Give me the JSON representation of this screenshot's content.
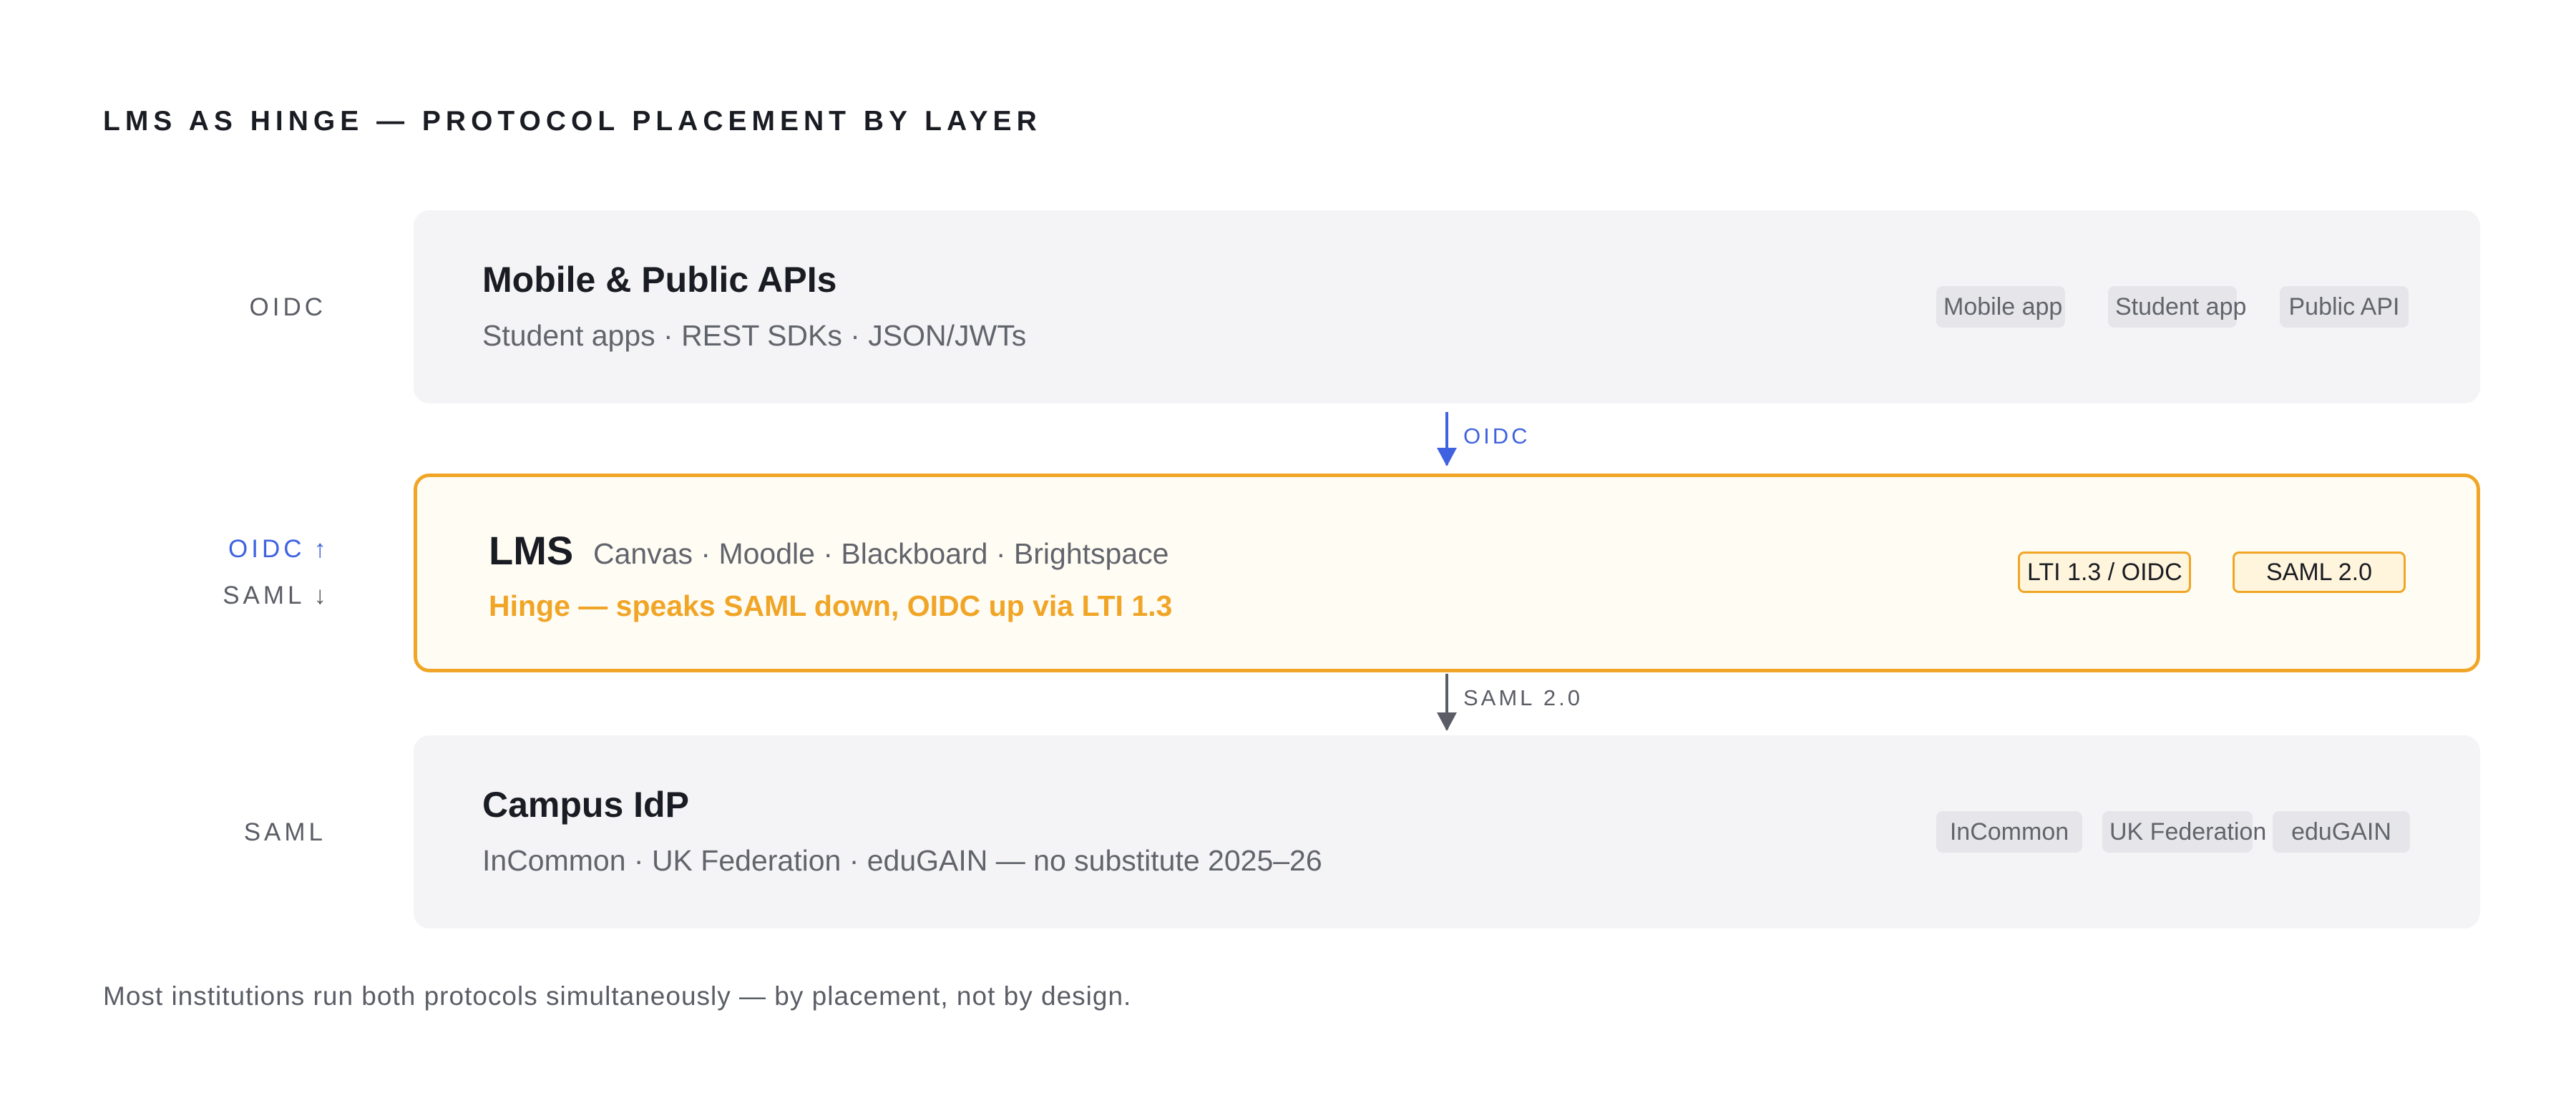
{
  "title": "LMS AS HINGE — PROTOCOL PLACEMENT BY LAYER",
  "layers": {
    "mobile": {
      "side_label": "OIDC",
      "title": "Mobile & Public APIs",
      "subtitle": "Student apps · REST SDKs · JSON/JWTs",
      "chips": [
        "Mobile app",
        "Student app",
        "Public API"
      ]
    },
    "lms": {
      "side_label_up": "OIDC",
      "side_label_up_arrow": "↑",
      "side_label_down": "SAML",
      "side_label_down_arrow": "↓",
      "title": "LMS",
      "platforms": "Canvas · Moodle · Blackboard · Brightspace",
      "note": "Hinge — speaks SAML down, OIDC up via LTI 1.3",
      "chips": [
        "LTI 1.3 / OIDC",
        "SAML 2.0"
      ]
    },
    "idp": {
      "side_label": "SAML",
      "title": "Campus IdP",
      "subtitle": "InCommon · UK Federation · eduGAIN — no substitute 2025–26",
      "chips": [
        "InCommon",
        "UK Federation",
        "eduGAIN"
      ]
    }
  },
  "connectors": {
    "top": {
      "label": "OIDC",
      "color": "#3f63e0"
    },
    "bottom": {
      "label": "SAML 2.0",
      "color": "#5b5d66"
    }
  },
  "footer": "Most institutions run both protocols simultaneously — by placement, not by design.",
  "colors": {
    "accent_gold": "#f0a526",
    "accent_blue": "#3f63e0",
    "layer_bg": "#f4f4f6"
  }
}
